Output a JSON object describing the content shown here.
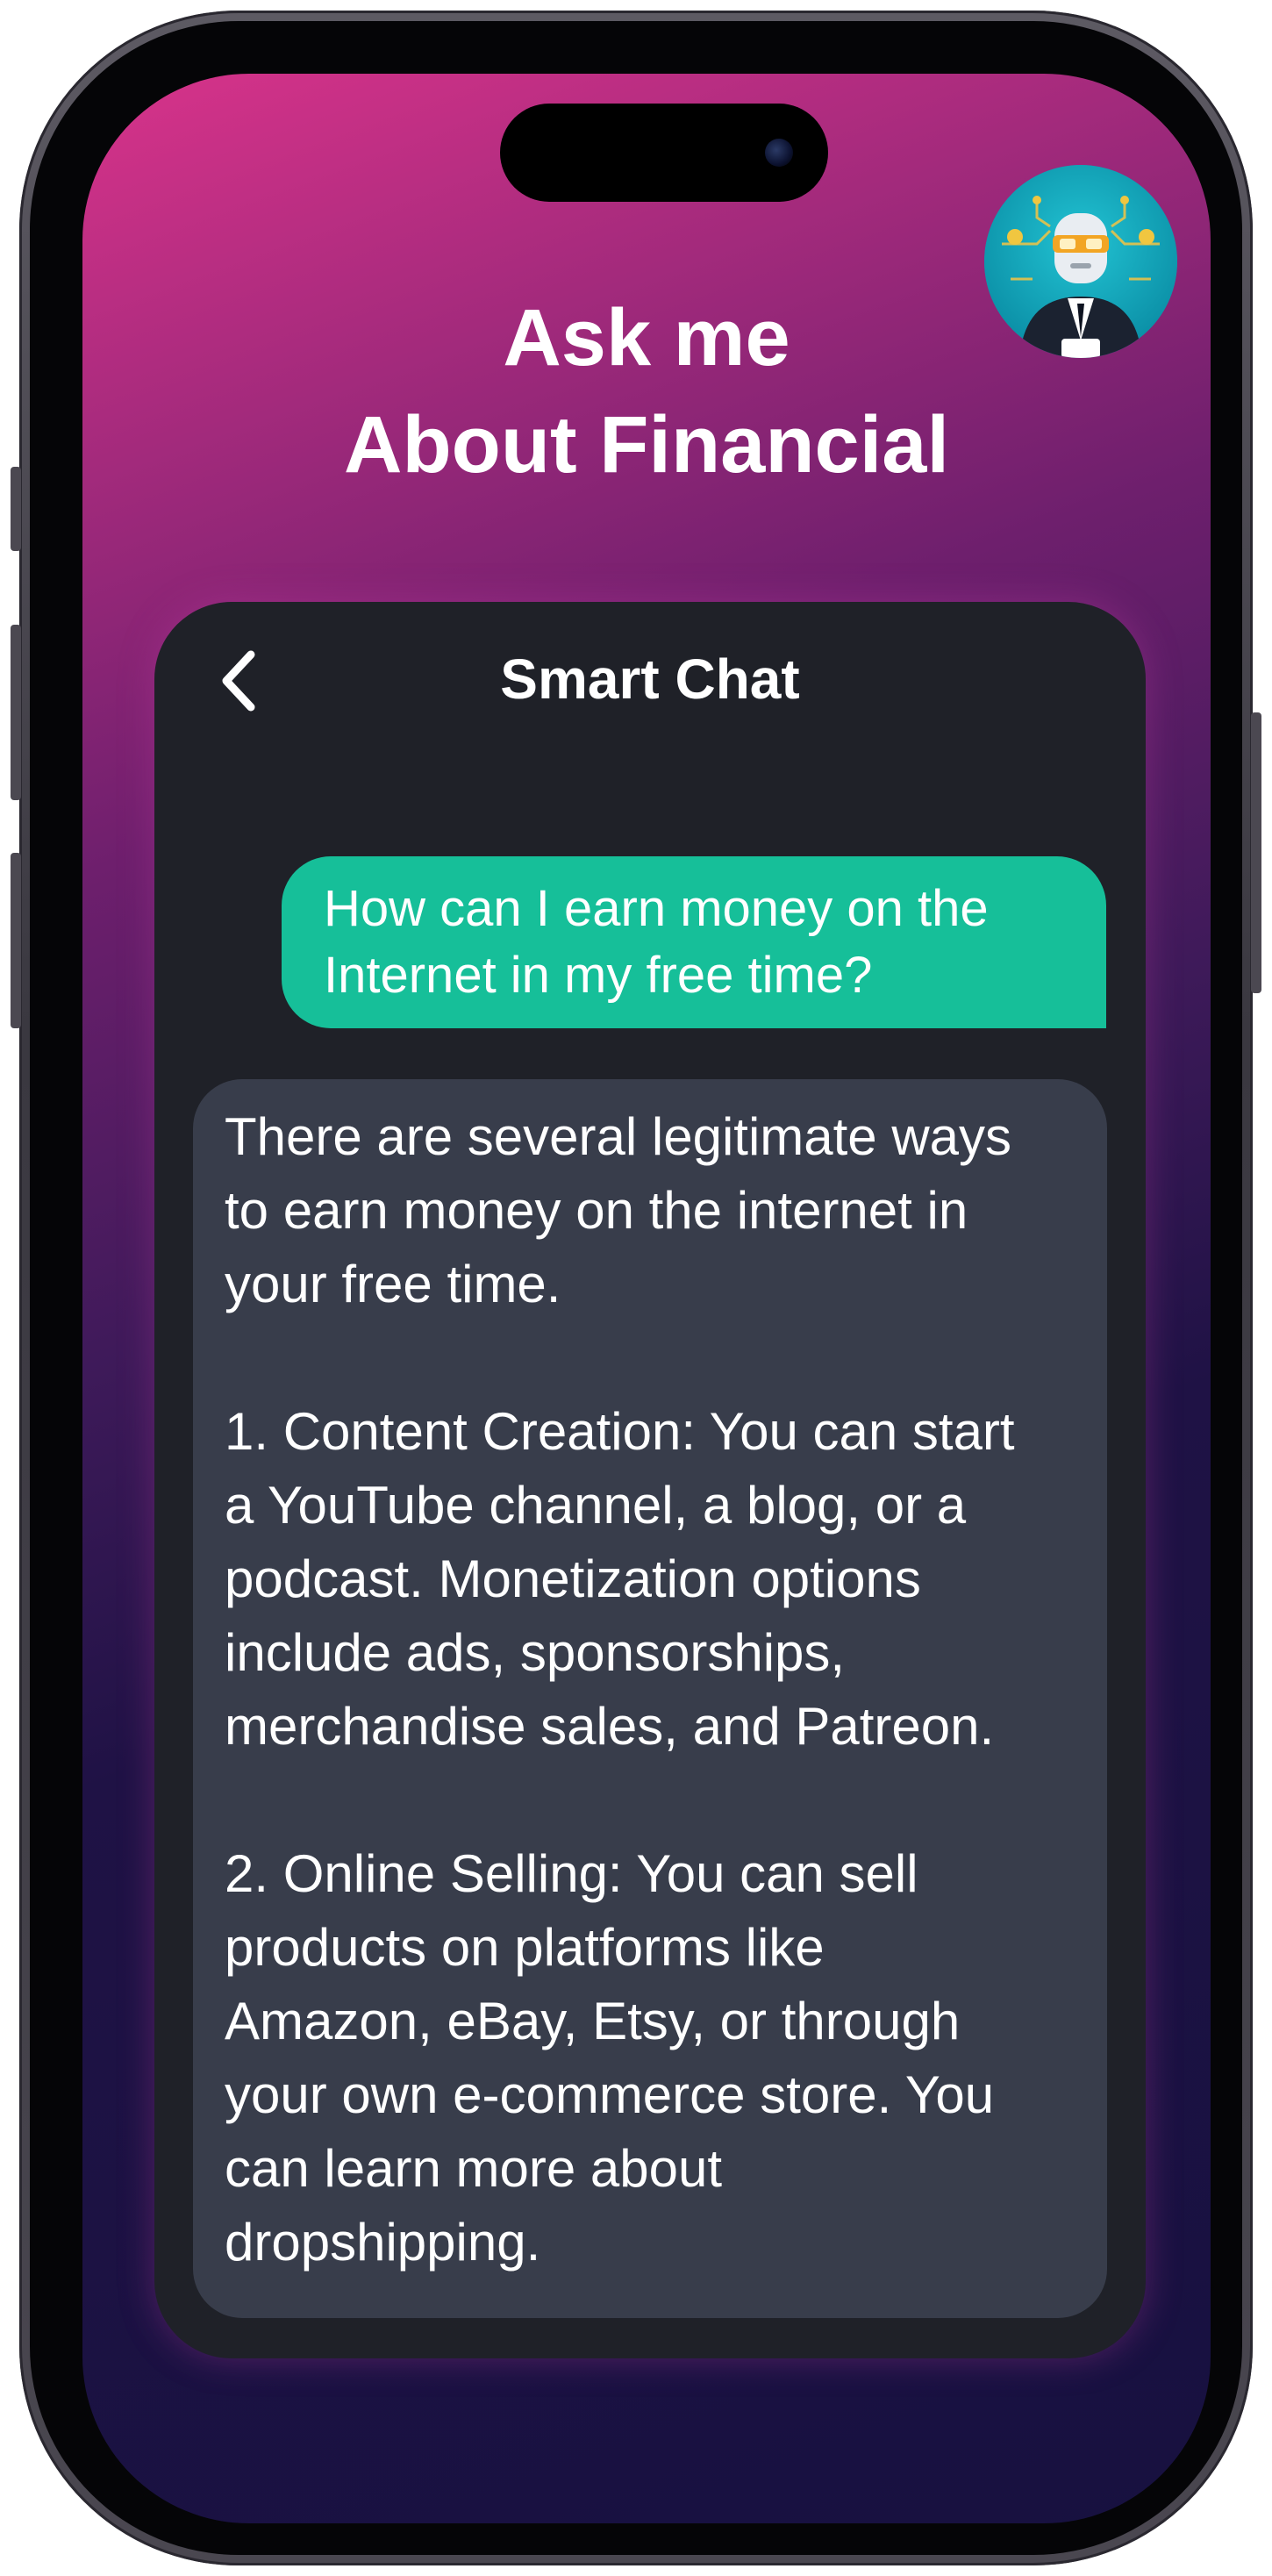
{
  "hero": {
    "title_line1": "Ask me",
    "title_line2": "About Financial"
  },
  "chat": {
    "title": "Smart Chat",
    "back_icon": "chevron-left-icon",
    "user_message": {
      "line1": "How can I earn money on the",
      "line2": "Internet in my free time?"
    },
    "bot_message": {
      "lines": [
        "There are several legitimate ways",
        "to earn money on the internet in",
        "your free time.",
        "",
        "1. Content Creation: You can start",
        "a YouTube channel, a blog, or a",
        "podcast. Monetization options",
        "include ads, sponsorships,",
        "merchandise sales, and Patreon.",
        "",
        "2. Online Selling: You can sell",
        "products on platforms like",
        "Amazon, eBay, Etsy, or through",
        "your own e-commerce store. You",
        "can learn more about",
        "dropshipping."
      ]
    }
  },
  "colors": {
    "accent_green": "#16bf99",
    "card_bg": "#1f2128",
    "bot_bubble_bg": "#383d4b",
    "gradient_top": "#d8338a",
    "gradient_bottom": "#171140"
  },
  "avatar": {
    "icon": "robot-advisor-avatar-icon"
  }
}
